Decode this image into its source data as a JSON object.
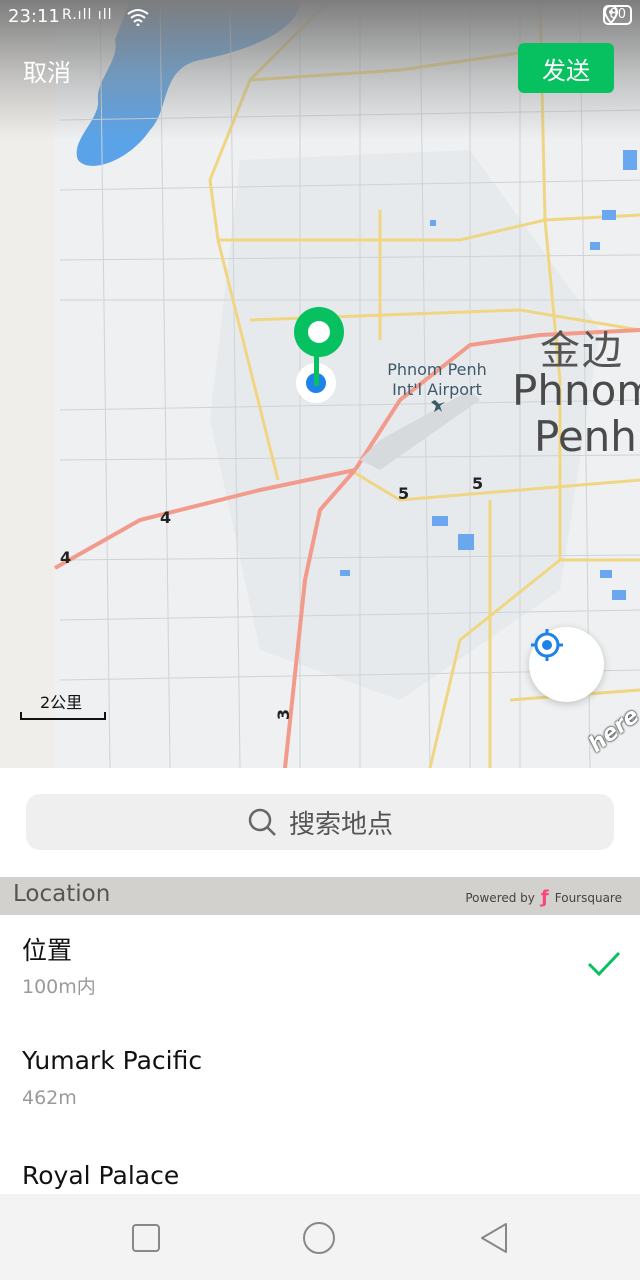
{
  "status_bar": {
    "time": "23:11",
    "signal_text": "R.ıll ıll",
    "battery": "80",
    "icons": [
      "wifi-icon",
      "location-icon",
      "battery-icon"
    ]
  },
  "header": {
    "cancel_label": "取消",
    "send_label": "发送",
    "accent_color": "#07c160"
  },
  "map": {
    "city_label_cn": "金边",
    "city_label_line1": "Phnom",
    "city_label_line2": "Penh",
    "airport_label_line1": "Phnom Penh",
    "airport_label_line2": "Int'l Airport",
    "road_numbers": [
      "4",
      "4",
      "5",
      "5",
      "3"
    ],
    "scale_label": "2公里",
    "provider_logo": "here"
  },
  "search": {
    "placeholder": "搜索地点",
    "icon": "search-icon"
  },
  "section": {
    "title": "Location",
    "powered_by": "Powered by",
    "provider": "Foursquare"
  },
  "places": [
    {
      "name": "位置",
      "distance": "100m内",
      "selected": true
    },
    {
      "name": "Yumark Pacific",
      "distance": "462m",
      "selected": false
    },
    {
      "name": "Royal Palace",
      "distance": "",
      "selected": false
    }
  ],
  "nav": {
    "icons": [
      "recent-apps-icon",
      "home-icon",
      "back-icon"
    ]
  }
}
